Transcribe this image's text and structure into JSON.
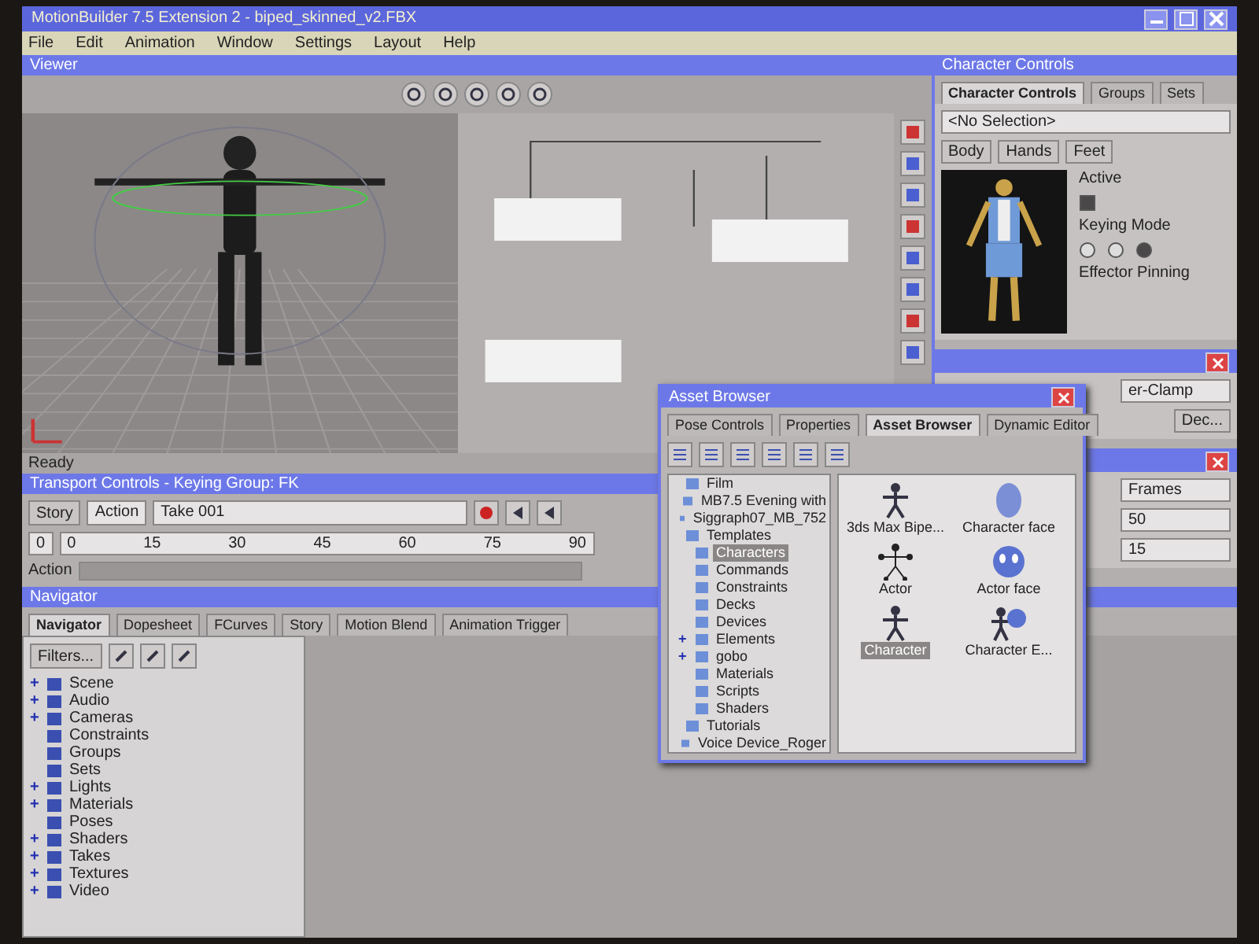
{
  "window": {
    "title": "MotionBuilder 7.5 Extension 2 - biped_skinned_v2.FBX"
  },
  "menu": [
    "File",
    "Edit",
    "Animation",
    "Window",
    "Settings",
    "Layout",
    "Help"
  ],
  "viewer": {
    "title": "Viewer",
    "status": "Ready"
  },
  "transport": {
    "title": "Transport Controls  -  Keying Group: FK",
    "mode": "Story",
    "action": "Action",
    "take": "Take 001",
    "frame": "0",
    "ticks": [
      "0",
      "15",
      "30",
      "45",
      "60",
      "75",
      "90"
    ],
    "track_label": "Action"
  },
  "navigator": {
    "title": "Navigator",
    "tabs": [
      {
        "label": "Navigator",
        "selected": true
      },
      {
        "label": "Dopesheet",
        "selected": false
      },
      {
        "label": "FCurves",
        "selected": false
      },
      {
        "label": "Story",
        "selected": false
      },
      {
        "label": "Motion Blend",
        "selected": false
      },
      {
        "label": "Animation Trigger",
        "selected": false
      }
    ],
    "filter_button": "Filters...",
    "tree": [
      {
        "label": "Scene",
        "toggle": "+"
      },
      {
        "label": "Audio",
        "toggle": "+"
      },
      {
        "label": "Cameras",
        "toggle": "+"
      },
      {
        "label": "Constraints"
      },
      {
        "label": "Groups"
      },
      {
        "label": "Sets"
      },
      {
        "label": "Lights",
        "toggle": "+"
      },
      {
        "label": "Materials",
        "toggle": "+"
      },
      {
        "label": "Poses"
      },
      {
        "label": "Shaders",
        "toggle": "+"
      },
      {
        "label": "Takes",
        "toggle": "+"
      },
      {
        "label": "Textures",
        "toggle": "+"
      },
      {
        "label": "Video",
        "toggle": "+"
      }
    ]
  },
  "character_controls": {
    "title": "Character Controls",
    "tabs": [
      {
        "label": "Character Controls",
        "selected": true
      },
      {
        "label": "Groups",
        "selected": false
      },
      {
        "label": "Sets",
        "selected": false
      }
    ],
    "selection": "<No Selection>",
    "body_buttons": [
      "Body",
      "Hands",
      "Feet"
    ],
    "active_label": "Active",
    "active": true,
    "keying_mode_label": "Keying Mode",
    "keying_modes": [
      {
        "selected": false
      },
      {
        "selected": false
      },
      {
        "selected": true
      }
    ],
    "effector_label": "Effector Pinning"
  },
  "small_windows": [
    {
      "dropdown": "er-Clamp",
      "button": "Dec..."
    },
    {
      "dropdown": "Frames",
      "fields": [
        "50",
        "15"
      ]
    }
  ],
  "asset_browser": {
    "title": "Asset Browser",
    "tabs": [
      {
        "label": "Pose Controls",
        "selected": false
      },
      {
        "label": "Properties",
        "selected": false
      },
      {
        "label": "Asset Browser",
        "selected": true
      },
      {
        "label": "Dynamic Editor",
        "selected": false
      }
    ],
    "tree": [
      {
        "label": "Film",
        "selected": false
      },
      {
        "label": "MB7.5 Evening with",
        "selected": false
      },
      {
        "label": "Siggraph07_MB_752",
        "selected": false
      },
      {
        "label": "Templates",
        "selected": false,
        "children": [
          {
            "label": "Characters",
            "selected": true
          },
          {
            "label": "Commands",
            "selected": false
          },
          {
            "label": "Constraints",
            "selected": false
          },
          {
            "label": "Decks",
            "selected": false
          },
          {
            "label": "Devices",
            "selected": false
          },
          {
            "label": "Elements",
            "selected": false,
            "toggle": "+"
          },
          {
            "label": "gobo",
            "selected": false,
            "toggle": "+"
          },
          {
            "label": "Materials",
            "selected": false
          },
          {
            "label": "Scripts",
            "selected": false
          },
          {
            "label": "Shaders",
            "selected": false
          }
        ]
      },
      {
        "label": "Tutorials",
        "selected": false
      },
      {
        "label": "Voice Device_Roger",
        "selected": false
      }
    ],
    "assets": [
      {
        "label": "3ds Max Bipe...",
        "kind": "biped",
        "selected": false
      },
      {
        "label": "Character face",
        "kind": "face",
        "selected": false
      },
      {
        "label": "Actor",
        "kind": "actor",
        "selected": false
      },
      {
        "label": "Actor face",
        "kind": "mask",
        "selected": false
      },
      {
        "label": "Character",
        "kind": "biped",
        "selected": true
      },
      {
        "label": "Character E...",
        "kind": "editor",
        "selected": false
      }
    ]
  }
}
